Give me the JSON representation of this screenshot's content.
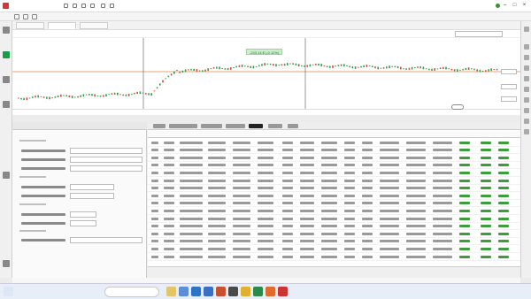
{
  "chart": {
    "measure_label": "-243.14 $ (-0.12%)",
    "colors": {
      "bull": "#2e9e48",
      "bear": "#d84a35",
      "price_line": "#e5844d",
      "cursor": "#333333"
    }
  },
  "icons": {
    "sidebar": [
      "chart-icon",
      "settings-icon",
      "strategy-icon",
      "list-icon",
      "link-icon",
      "alert-icon"
    ],
    "right_sidebar": [
      "lock-icon",
      "cursor-icon",
      "pencil-icon",
      "line-icon",
      "fib-icon",
      "text-icon",
      "ruler-icon",
      "zoom-icon",
      "magnet-icon",
      "trash-icon"
    ]
  },
  "taskbar": {
    "search_icon": "search-icon",
    "apps": [
      "task-view-icon",
      "file-explorer-icon",
      "store-icon",
      "outlook-icon",
      "word-icon",
      "powerpoint-icon",
      "chrome-icon",
      "terminal-icon",
      "excel-icon",
      "firefox-icon",
      "mt5-icon"
    ]
  }
}
